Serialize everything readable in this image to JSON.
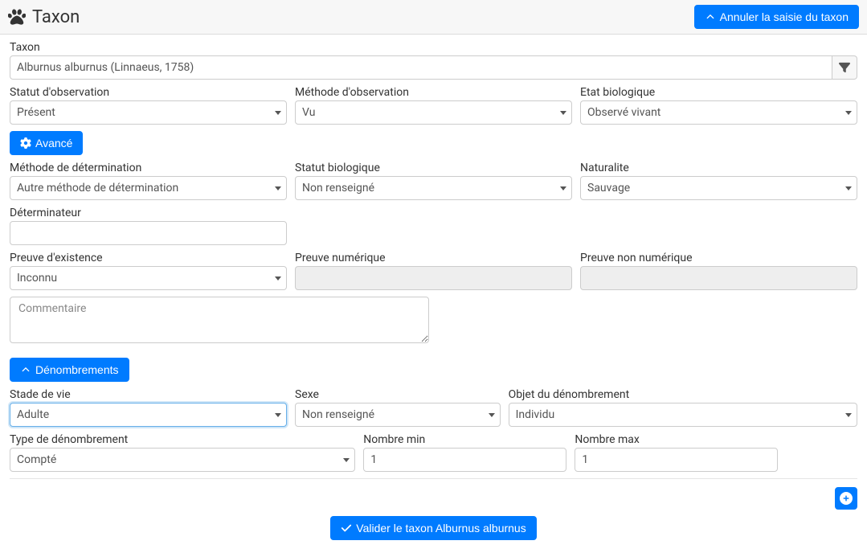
{
  "header": {
    "title": "Taxon",
    "cancel_label": "Annuler la saisie du taxon"
  },
  "advanced_label": "Avancé",
  "denombrements_label": "Dénombrements",
  "validate_label": "Valider le taxon Alburnus alburnus",
  "fields": {
    "taxon": {
      "label": "Taxon",
      "value": "Alburnus alburnus (Linnaeus, 1758)"
    },
    "statut_obs": {
      "label": "Statut d'observation",
      "value": "Présent"
    },
    "methode_obs": {
      "label": "Méthode d'observation",
      "value": "Vu"
    },
    "etat_bio": {
      "label": "Etat biologique",
      "value": "Observé vivant"
    },
    "methode_det": {
      "label": "Méthode de détermination",
      "value": "Autre méthode de détermination"
    },
    "statut_bio": {
      "label": "Statut biologique",
      "value": "Non renseigné"
    },
    "naturalite": {
      "label": "Naturalite",
      "value": "Sauvage"
    },
    "determinateur": {
      "label": "Déterminateur",
      "value": ""
    },
    "preuve_exist": {
      "label": "Preuve d'existence",
      "value": "Inconnu"
    },
    "preuve_num": {
      "label": "Preuve numérique",
      "value": ""
    },
    "preuve_non_num": {
      "label": "Preuve non numérique",
      "value": ""
    },
    "commentaire": {
      "placeholder": "Commentaire"
    },
    "stade_vie": {
      "label": "Stade de vie",
      "value": "Adulte"
    },
    "sexe": {
      "label": "Sexe",
      "value": "Non renseigné"
    },
    "objet_denom": {
      "label": "Objet du dénombrement",
      "value": "Individu"
    },
    "type_denom": {
      "label": "Type de dénombrement",
      "value": "Compté"
    },
    "nombre_min": {
      "label": "Nombre min",
      "value": "1"
    },
    "nombre_max": {
      "label": "Nombre max",
      "value": "1"
    }
  }
}
